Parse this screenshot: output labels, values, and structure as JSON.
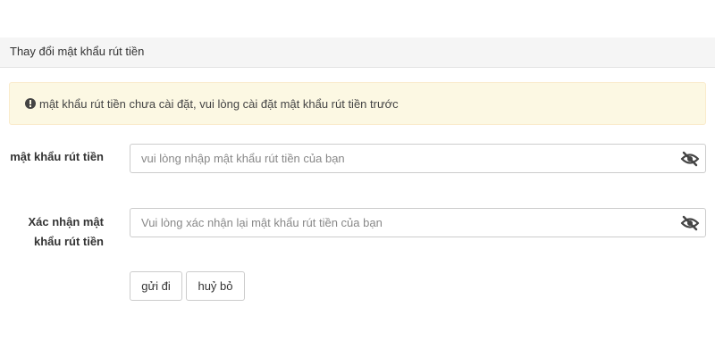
{
  "panel": {
    "title": "Thay đổi mật khẩu rút tiền"
  },
  "alert": {
    "icon": "exclamation-circle-icon",
    "message": "mật khẩu rút tiền chưa cài đặt, vui lòng cài đặt mật khẩu rút tiền trước",
    "background_color": "#fcf8e3"
  },
  "form": {
    "password": {
      "label": "mật khẩu rút tiền",
      "value": "",
      "placeholder": "vui lòng nhập mật khẩu rút tiền của bạn",
      "toggle_icon": "eye-slash-icon"
    },
    "confirm_password": {
      "label": "Xác nhận mật khẩu rút tiền",
      "value": "",
      "placeholder": "Vui lòng xác nhận lại mật khẩu rút tiền của bạn",
      "toggle_icon": "eye-slash-icon"
    },
    "buttons": {
      "submit_label": "gửi đi",
      "cancel_label": "huỷ bỏ"
    }
  }
}
